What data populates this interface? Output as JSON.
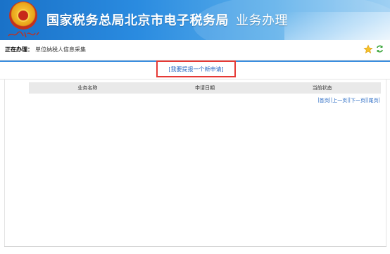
{
  "header": {
    "title": "国家税务总局北京市电子税务局",
    "subtitle": "业务办理"
  },
  "taskbar": {
    "label": "正在办理：",
    "value": "单位纳税人信息采集"
  },
  "apply": {
    "label": "[我要提报一个新申请]"
  },
  "table": {
    "columns": [
      "业务名称",
      "申请日期",
      "当前状态"
    ]
  },
  "pager": {
    "first": "首页",
    "prev": "上一页",
    "next": "下一页",
    "last": "尾页",
    "separator": "|"
  },
  "colors": {
    "header_blue": "#1a72c8",
    "link_blue": "#2a6bc4",
    "highlight_red": "#e53935"
  }
}
